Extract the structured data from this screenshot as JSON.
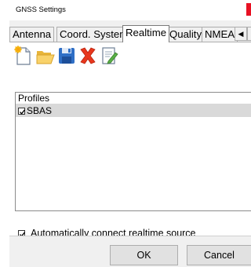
{
  "window": {
    "title": "GNSS Settings"
  },
  "tabs": [
    {
      "label": "Antenna"
    },
    {
      "label": "Coord. System"
    },
    {
      "label": "Realtime",
      "active": true
    },
    {
      "label": "Quality"
    },
    {
      "label": "NMEA"
    }
  ],
  "toolbar": {
    "icons": [
      "new-document-icon",
      "open-folder-icon",
      "save-floppy-icon",
      "delete-x-icon",
      "edit-document-icon"
    ]
  },
  "profiles": {
    "header": "Profiles",
    "items": [
      {
        "label": "SBAS",
        "checked": true
      }
    ]
  },
  "auto_connect": {
    "label": "Automatically connect realtime source",
    "checked": true
  },
  "buttons": {
    "ok": "OK",
    "cancel": "Cancel"
  },
  "colors": {
    "close_red": "#e81123",
    "dialog_bg": "#f0f0f0",
    "selected_row": "#d9d9d9"
  }
}
